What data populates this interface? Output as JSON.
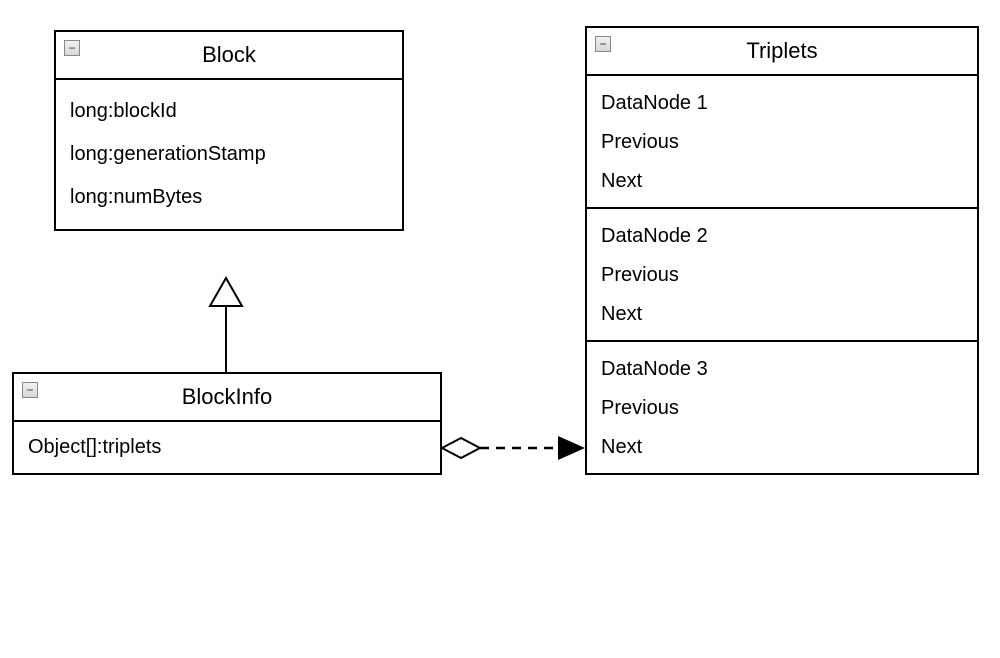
{
  "classes": {
    "block": {
      "name": "Block",
      "attributes": [
        "long:blockId",
        "long:generationStamp",
        "long:numBytes"
      ]
    },
    "blockInfo": {
      "name": "BlockInfo",
      "attributes": [
        "Object[]:triplets"
      ]
    },
    "triplets": {
      "name": "Triplets",
      "sections": [
        {
          "items": [
            "DataNode 1",
            "Previous",
            "Next"
          ]
        },
        {
          "items": [
            "DataNode 2",
            "Previous",
            "Next"
          ]
        },
        {
          "items": [
            "DataNode 3",
            "Previous",
            "Next"
          ]
        }
      ]
    }
  },
  "relations": [
    {
      "type": "generalization",
      "from": "BlockInfo",
      "to": "Block"
    },
    {
      "type": "aggregation-dependency",
      "from": "BlockInfo",
      "to": "Triplets"
    }
  ],
  "icons": {
    "collapse": "−"
  }
}
